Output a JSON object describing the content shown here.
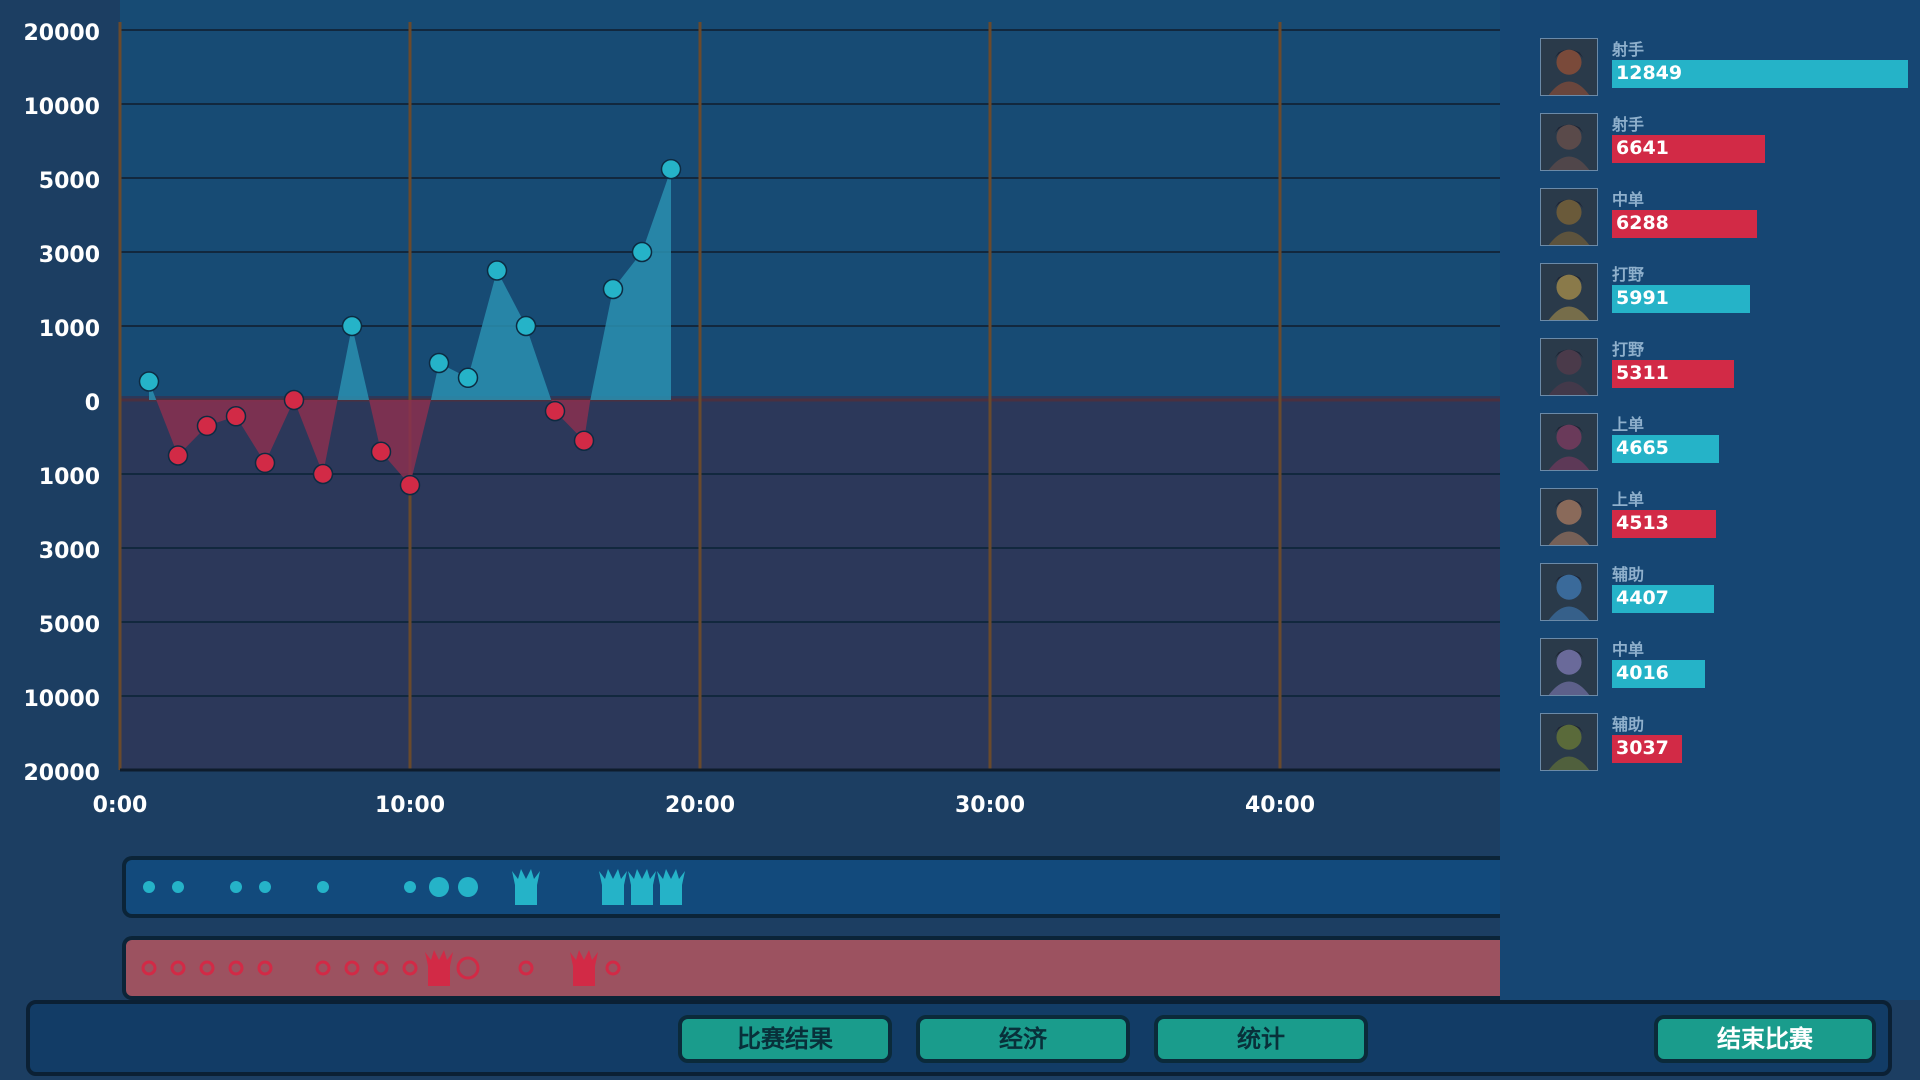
{
  "chart_data": {
    "type": "line",
    "y_tick_labels": [
      "20000",
      "10000",
      "5000",
      "3000",
      "1000",
      "0",
      "1000",
      "3000",
      "5000",
      "10000",
      "20000"
    ],
    "x_tick_labels": [
      "0:00",
      "10:00",
      "20:00",
      "30:00",
      "40:00"
    ],
    "x_unit": "minutes",
    "x_ticks": [
      0,
      10,
      20,
      30,
      40
    ],
    "xlim": [
      0,
      47
    ],
    "ylim": [
      -20000,
      20000
    ],
    "grid": true,
    "series": [
      {
        "color": "#25b3c8",
        "x": [
          1,
          2,
          3,
          4,
          5,
          6,
          7,
          8,
          9,
          10,
          11,
          12,
          13,
          14,
          15,
          16,
          17,
          18,
          19
        ],
        "y": [
          250,
          -750,
          -350,
          -220,
          -850,
          0,
          -1000,
          1000,
          -700,
          -1300,
          500,
          300,
          2500,
          1000,
          -150,
          -550,
          2000,
          3000,
          5600
        ]
      }
    ],
    "point_colors": [
      "#25b3c8",
      "#d22a46",
      "#d22a46",
      "#d22a46",
      "#d22a46",
      "#d22a46",
      "#d22a46",
      "#25b3c8",
      "#d22a46",
      "#d22a46",
      "#25b3c8",
      "#25b3c8",
      "#25b3c8",
      "#25b3c8",
      "#d22a46",
      "#d22a46",
      "#25b3c8",
      "#25b3c8",
      "#25b3c8"
    ]
  },
  "timelines": {
    "blue": {
      "color": "#25b3c8",
      "events": [
        {
          "t": 1,
          "kind": "small"
        },
        {
          "t": 2,
          "kind": "small"
        },
        {
          "t": 4,
          "kind": "small"
        },
        {
          "t": 5,
          "kind": "small"
        },
        {
          "t": 7,
          "kind": "small"
        },
        {
          "t": 10,
          "kind": "small"
        },
        {
          "t": 11,
          "kind": "large"
        },
        {
          "t": 12,
          "kind": "large"
        },
        {
          "t": 14,
          "kind": "tower"
        },
        {
          "t": 17,
          "kind": "tower"
        },
        {
          "t": 18,
          "kind": "tower"
        },
        {
          "t": 19,
          "kind": "tower"
        }
      ]
    },
    "red": {
      "color": "#d22a46",
      "events": [
        {
          "t": 1,
          "kind": "small"
        },
        {
          "t": 2,
          "kind": "small"
        },
        {
          "t": 3,
          "kind": "small"
        },
        {
          "t": 4,
          "kind": "small"
        },
        {
          "t": 5,
          "kind": "small"
        },
        {
          "t": 7,
          "kind": "small"
        },
        {
          "t": 8,
          "kind": "small"
        },
        {
          "t": 9,
          "kind": "small"
        },
        {
          "t": 10,
          "kind": "small"
        },
        {
          "t": 11,
          "kind": "tower"
        },
        {
          "t": 12,
          "kind": "large"
        },
        {
          "t": 14,
          "kind": "small"
        },
        {
          "t": 16,
          "kind": "tower"
        },
        {
          "t": 17,
          "kind": "small"
        }
      ]
    }
  },
  "players": [
    {
      "role": "射手",
      "gold": "12849",
      "value": 12849,
      "team": "blue",
      "avatar": "hero-portrait-icon"
    },
    {
      "role": "射手",
      "gold": "6641",
      "value": 6641,
      "team": "red",
      "avatar": "hero-portrait-icon"
    },
    {
      "role": "中单",
      "gold": "6288",
      "value": 6288,
      "team": "red",
      "avatar": "hero-portrait-icon"
    },
    {
      "role": "打野",
      "gold": "5991",
      "value": 5991,
      "team": "blue",
      "avatar": "hero-portrait-icon"
    },
    {
      "role": "打野",
      "gold": "5311",
      "value": 5311,
      "team": "red",
      "avatar": "hero-portrait-icon"
    },
    {
      "role": "上单",
      "gold": "4665",
      "value": 4665,
      "team": "blue",
      "avatar": "hero-portrait-icon"
    },
    {
      "role": "上单",
      "gold": "4513",
      "value": 4513,
      "team": "red",
      "avatar": "hero-portrait-icon"
    },
    {
      "role": "辅助",
      "gold": "4407",
      "value": 4407,
      "team": "blue",
      "avatar": "hero-portrait-icon"
    },
    {
      "role": "中单",
      "gold": "4016",
      "value": 4016,
      "team": "blue",
      "avatar": "hero-portrait-icon"
    },
    {
      "role": "辅助",
      "gold": "3037",
      "value": 3037,
      "team": "red",
      "avatar": "hero-portrait-icon"
    }
  ],
  "team_colors": {
    "blue": "#25b3c8",
    "red": "#d22a46"
  },
  "buttons": {
    "match_result": "比赛结果",
    "economy": "经济",
    "stats": "统计",
    "end_match": "结束比赛"
  }
}
